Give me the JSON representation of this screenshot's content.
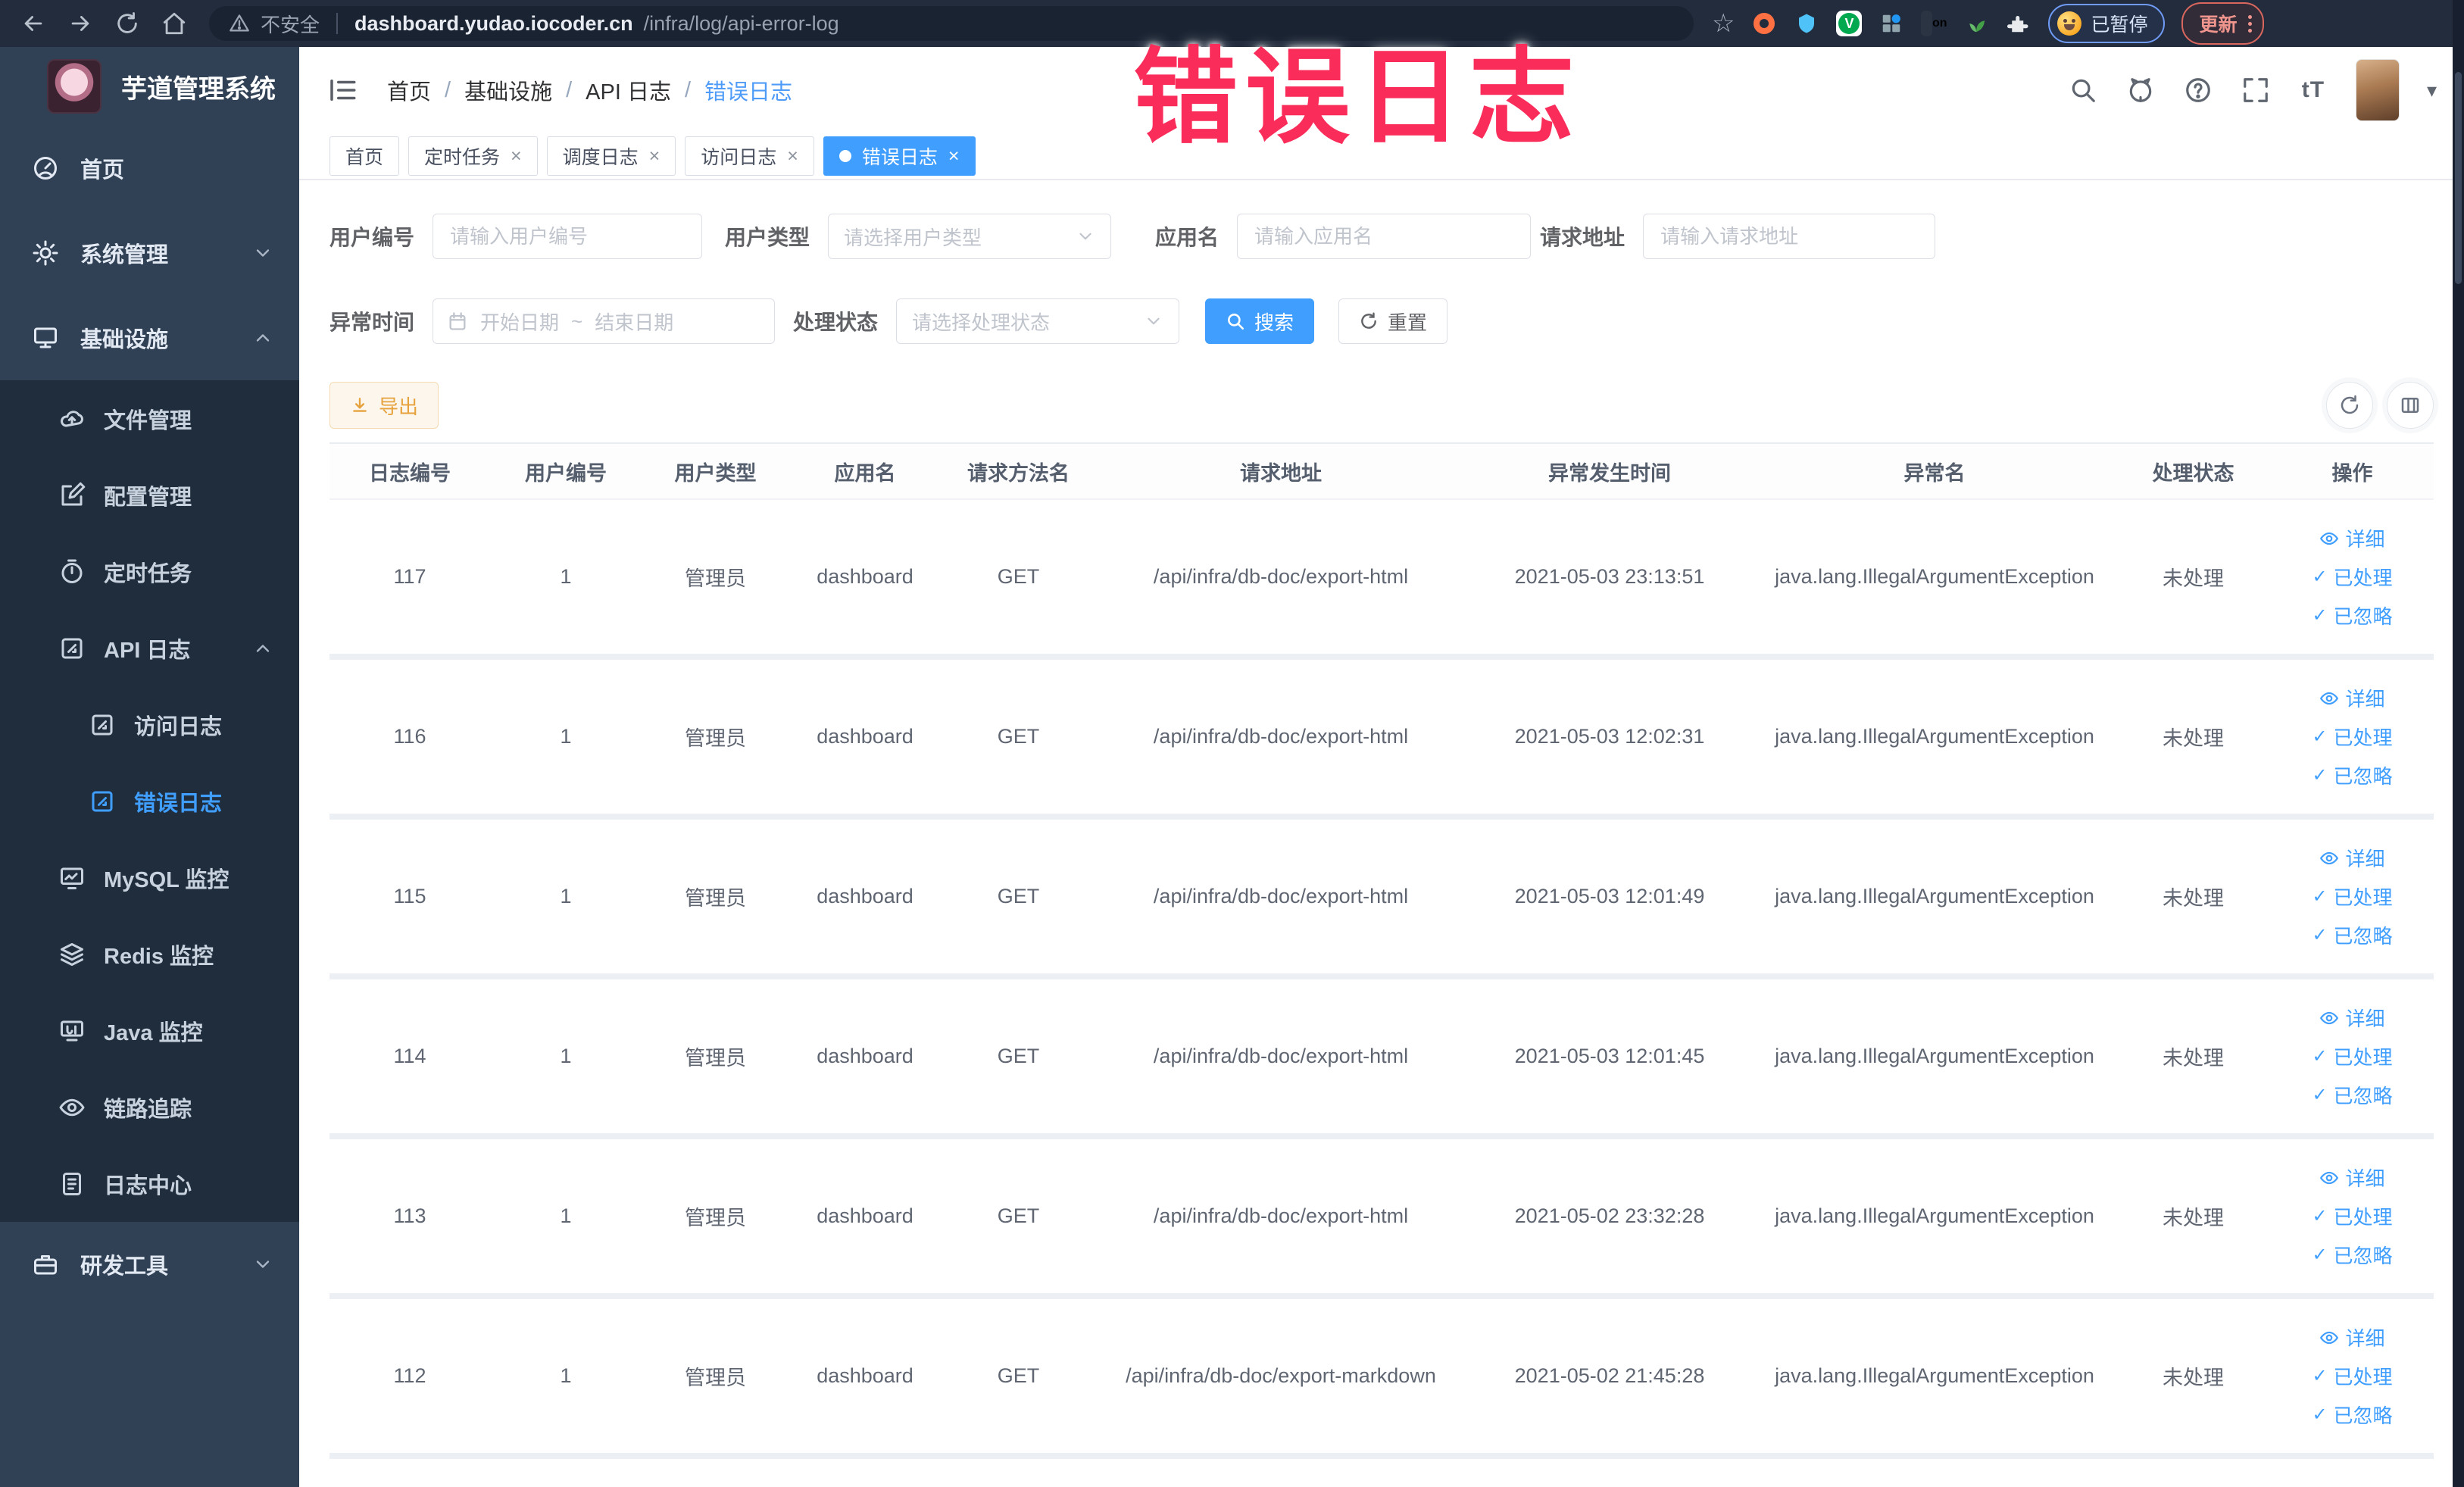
{
  "browser": {
    "security_label": "不安全",
    "host": "dashboard.yudao.iocoder.cn",
    "path": "/infra/log/api-error-log",
    "extension_on_badge": "on",
    "paused_badge": "已暂停",
    "update_button": "更新"
  },
  "watermark": "错误日志",
  "sidebar": {
    "title": "芋道管理系统",
    "items": [
      {
        "label": "首页",
        "icon": "home-icon"
      },
      {
        "label": "系统管理",
        "icon": "gear-icon"
      },
      {
        "label": "基础设施",
        "icon": "infra-icon"
      },
      {
        "label": "文件管理",
        "icon": "file-icon"
      },
      {
        "label": "配置管理",
        "icon": "config-icon"
      },
      {
        "label": "定时任务",
        "icon": "job-icon"
      },
      {
        "label": "API 日志",
        "icon": "api-log-icon"
      },
      {
        "label": "访问日志",
        "icon": "access-log-icon"
      },
      {
        "label": "错误日志",
        "icon": "error-log-icon"
      },
      {
        "label": "MySQL 监控",
        "icon": "mysql-icon"
      },
      {
        "label": "Redis 监控",
        "icon": "redis-icon"
      },
      {
        "label": "Java 监控",
        "icon": "java-icon"
      },
      {
        "label": "链路追踪",
        "icon": "trace-icon"
      },
      {
        "label": "日志中心",
        "icon": "log-center-icon"
      },
      {
        "label": "研发工具",
        "icon": "tools-icon"
      }
    ]
  },
  "breadcrumb": {
    "separator": "/",
    "items": [
      "首页",
      "基础设施",
      "API 日志",
      "错误日志"
    ]
  },
  "tabs": [
    {
      "label": "首页"
    },
    {
      "label": "定时任务"
    },
    {
      "label": "调度日志"
    },
    {
      "label": "访问日志"
    },
    {
      "label": "错误日志"
    }
  ],
  "filters": {
    "user_id": {
      "label": "用户编号",
      "placeholder": "请输入用户编号"
    },
    "user_type": {
      "label": "用户类型",
      "placeholder": "请选择用户类型"
    },
    "app_name": {
      "label": "应用名",
      "placeholder": "请输入应用名"
    },
    "request_url": {
      "label": "请求地址",
      "placeholder": "请输入请求地址"
    },
    "exception_time": {
      "label": "异常时间",
      "start_placeholder": "开始日期",
      "separator": "~",
      "end_placeholder": "结束日期"
    },
    "process_status": {
      "label": "处理状态",
      "placeholder": "请选择处理状态"
    },
    "search_button": "搜索",
    "reset_button": "重置"
  },
  "toolbar": {
    "export_button": "导出"
  },
  "table": {
    "columns": [
      "日志编号",
      "用户编号",
      "用户类型",
      "应用名",
      "请求方法名",
      "请求地址",
      "异常发生时间",
      "异常名",
      "处理状态",
      "操作"
    ],
    "actions": [
      "详细",
      "已处理",
      "已忽略"
    ],
    "rows": [
      [
        "117",
        "1",
        "管理员",
        "dashboard",
        "GET",
        "/api/infra/db-doc/export-html",
        "2021-05-03 23:13:51",
        "java.lang.IllegalArgumentException",
        "未处理"
      ],
      [
        "116",
        "1",
        "管理员",
        "dashboard",
        "GET",
        "/api/infra/db-doc/export-html",
        "2021-05-03 12:02:31",
        "java.lang.IllegalArgumentException",
        "未处理"
      ],
      [
        "115",
        "1",
        "管理员",
        "dashboard",
        "GET",
        "/api/infra/db-doc/export-html",
        "2021-05-03 12:01:49",
        "java.lang.IllegalArgumentException",
        "未处理"
      ],
      [
        "114",
        "1",
        "管理员",
        "dashboard",
        "GET",
        "/api/infra/db-doc/export-html",
        "2021-05-03 12:01:45",
        "java.lang.IllegalArgumentException",
        "未处理"
      ],
      [
        "113",
        "1",
        "管理员",
        "dashboard",
        "GET",
        "/api/infra/db-doc/export-html",
        "2021-05-02 23:32:28",
        "java.lang.IllegalArgumentException",
        "未处理"
      ],
      [
        "112",
        "1",
        "管理员",
        "dashboard",
        "GET",
        "/api/infra/db-doc/export-markdown",
        "2021-05-02 21:45:28",
        "java.lang.IllegalArgumentException",
        "未处理"
      ]
    ]
  },
  "colors": {
    "accent": "#409eff",
    "warning": "#e6a23c",
    "sidebar_bg": "#304156",
    "submenu_bg": "#1f2d3d",
    "watermark": "#fa2c5a",
    "chrome_bg": "#222c3d"
  }
}
